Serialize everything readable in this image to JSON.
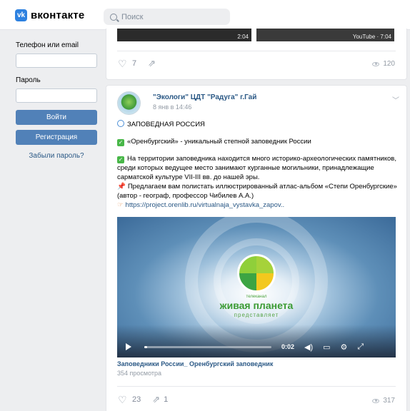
{
  "app": {
    "logo_text": "вконтакте",
    "logo_icon": "vk-logo-icon"
  },
  "search": {
    "placeholder": "Поиск"
  },
  "login": {
    "phone_label": "Телефон или email",
    "password_label": "Пароль",
    "login_button": "Войти",
    "register_button": "Регистрация",
    "forgot_link": "Забыли пароль?"
  },
  "prev_post": {
    "thumb1_duration": "2:04",
    "thumb2_duration": "YouTube · 7:04",
    "likes": "7",
    "views": "120"
  },
  "post": {
    "author": "\"Экологи\" ЦДТ \"Радуга\" г.Гай",
    "date": "8 янв в 14:46",
    "line1": "ЗАПОВЕДНАЯ РОССИЯ",
    "line2": "«Оренбургский» - уникальный степной заповедник России",
    "line3": "На территории заповедника находится много историко-археологических памятников, среди которых ведущее место занимают курганные могильники, принадлежащие сарматской культуре VII-III вв. до нашей эры.",
    "line4": "Предлагаем вам полистать иллюстрированный атлас-альбом «Степи Оренбургские» (автор - географ, профессор Чибилев А.А.)",
    "link": "https://project.orenlib.ru/virtualnaja_vystavka_zapov..",
    "video": {
      "overlay_small": "телеканал",
      "overlay_title": "живая планета",
      "overlay_sub": "представляет",
      "time": "0:02",
      "progress": 0.02,
      "title": "Заповедники России_ Оренбургский заповедник",
      "views": "354 просмотра"
    },
    "likes": "23",
    "shares": "1",
    "views": "317"
  }
}
